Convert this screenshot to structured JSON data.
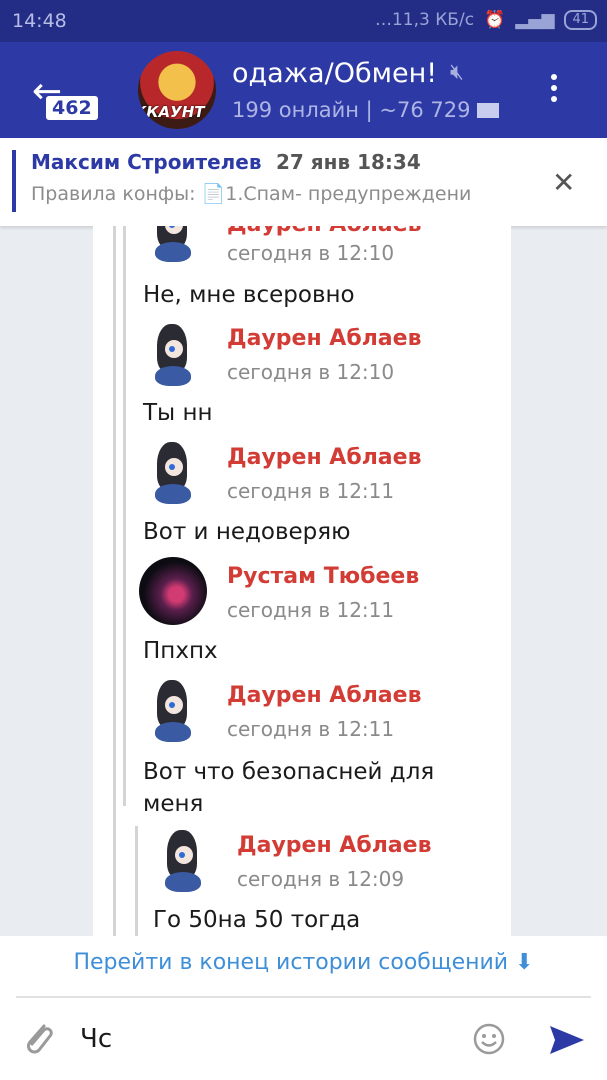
{
  "status": {
    "time": "14:48",
    "network": "…11,3 КБ/с",
    "battery": "41"
  },
  "header": {
    "badge": "462",
    "avatar_text": "ККАУНТ ДАЖ",
    "title": "одажа/Обмен!",
    "subtitle": "199 онлайн | ~76 729"
  },
  "pinned": {
    "author": "Максим Строителев",
    "date": "27 янв 18:34",
    "text": "Правила конфы: 📄1.Спам- предупреждени"
  },
  "messages": [
    {
      "author": "Даурен Аблаев",
      "time": "сегодня в 12:10",
      "text": "Не, мне всеровно"
    },
    {
      "author": "Даурен Аблаев",
      "time": "сегодня в 12:10",
      "text": "Ты нн"
    },
    {
      "author": "Даурен Аблаев",
      "time": "сегодня в 12:11",
      "text": "Вот и недоверяю"
    },
    {
      "author": "Рустам Тюбеев",
      "time": "сегодня в 12:11",
      "text": "Ппхпх"
    },
    {
      "author": "Даурен Аблаев",
      "time": "сегодня в 12:11",
      "text": "Вот что безопасней для меня"
    },
    {
      "author": "Даурен Аблаев",
      "time": "сегодня в 12:09",
      "text": "Го 50на 50 тогда"
    }
  ],
  "footer": {
    "jump_label": "Перейти в конец истории сообщений ⬇",
    "input_text": "Чс"
  },
  "colors": {
    "header": "#2d3aa6",
    "author": "#d23c35",
    "link": "#3f8fd8"
  }
}
